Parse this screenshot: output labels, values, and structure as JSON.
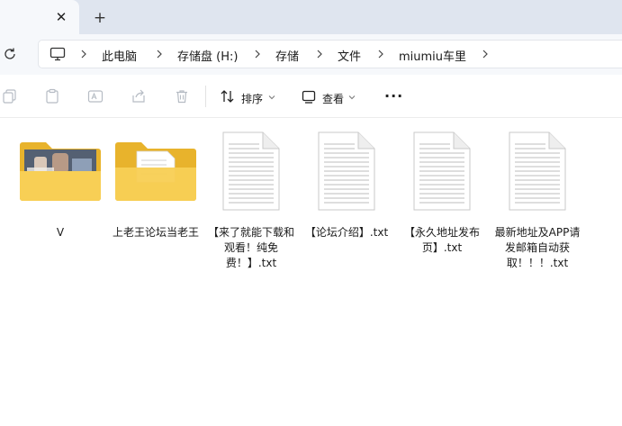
{
  "tabbar": {
    "close_glyph": "✕",
    "new_tab_glyph": "+"
  },
  "breadcrumb": {
    "items": [
      "此电脑",
      "存储盘 (H:)",
      "存储",
      "文件",
      "miumiu车里"
    ]
  },
  "toolbar": {
    "sort_label": "排序",
    "view_label": "查看",
    "more_glyph": "···"
  },
  "files": [
    {
      "name": "V",
      "type": "folder-photo"
    },
    {
      "name": "上老王论坛当老王",
      "type": "folder-doc"
    },
    {
      "name": "【来了就能下载和观看！纯免费！】.txt",
      "type": "txt"
    },
    {
      "name": "【论坛介绍】.txt",
      "type": "txt"
    },
    {
      "name": "【永久地址发布页】.txt",
      "type": "txt"
    },
    {
      "name": "最新地址及APP请发邮箱自动获取！！！.txt",
      "type": "txt"
    }
  ],
  "colors": {
    "folder_back": "#e8b32c",
    "folder_front": "#f8cf55",
    "tabbar_bg": "#dfe5ef"
  },
  "icons": [
    "close-icon",
    "plus-icon",
    "refresh-icon",
    "computer-icon",
    "chevron-right-icon",
    "copy-icon",
    "paste-icon",
    "rename-icon",
    "share-icon",
    "delete-icon",
    "sort-icon",
    "view-icon",
    "more-icon",
    "folder-icon",
    "text-file-icon"
  ]
}
